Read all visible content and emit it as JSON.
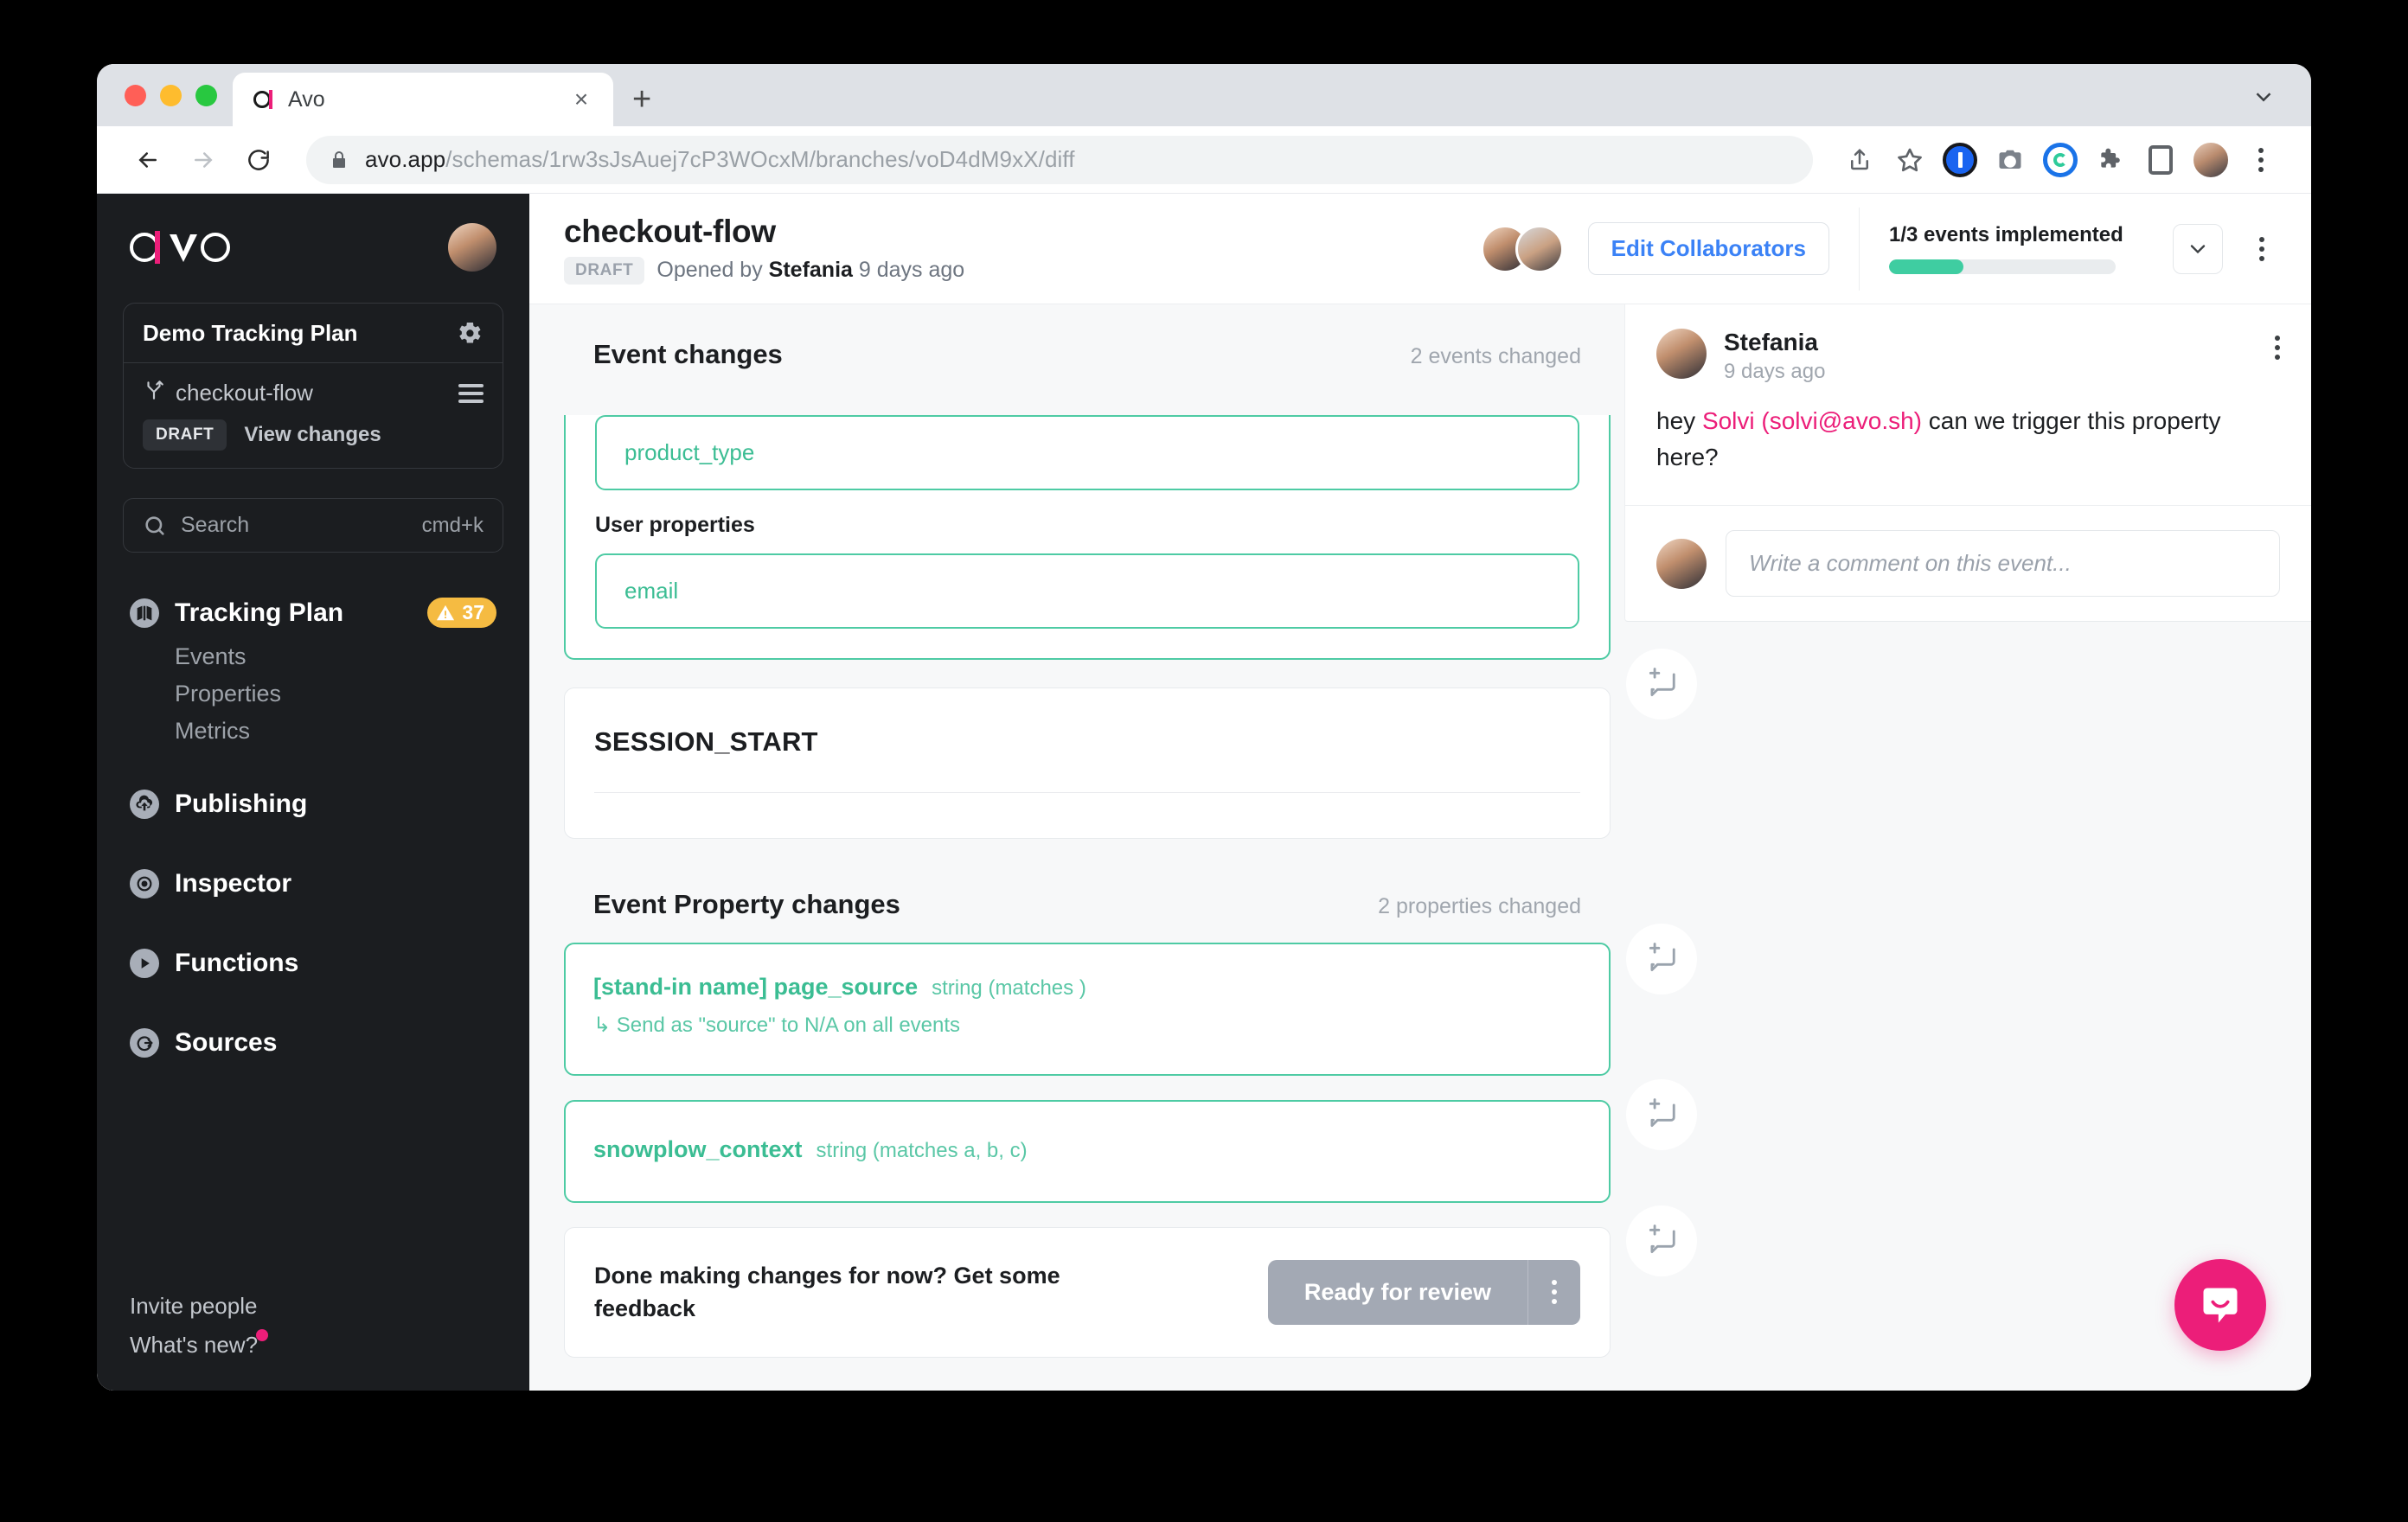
{
  "browser": {
    "tab": {
      "title": "Avo",
      "favicon": "avo-logo-icon",
      "close_icon": "close-icon"
    },
    "new_tab_icon": "plus-icon",
    "tab_list_icon": "chevron-down-icon",
    "back_icon": "back-arrow-icon",
    "forward_icon": "forward-arrow-icon",
    "reload_icon": "reload-icon",
    "url": {
      "host": "avo.app",
      "path": "/schemas/1rw3sJsAuej7cP3WOcxM/branches/voD4dM9xX/diff",
      "lock_icon": "lock-icon"
    },
    "toolbar_icons": [
      "share-icon",
      "bookmark-star-icon",
      "1password-icon",
      "screenshot-camera-icon",
      "sync-circle-icon",
      "extensions-puzzle-icon",
      "side-panel-icon",
      "profile-avatar-icon",
      "chrome-menu-icon"
    ]
  },
  "sidebar": {
    "logo": "avo-logo",
    "avatar": "user-avatar",
    "plan": {
      "name": "Demo Tracking Plan",
      "settings_icon": "gear-icon"
    },
    "branch": {
      "name": "checkout-flow",
      "branch_icon": "branch-icon",
      "menu_icon": "hamburger-icon",
      "status": "DRAFT",
      "action": "View changes"
    },
    "search": {
      "placeholder": "Search",
      "shortcut": "cmd+k",
      "icon": "search-icon"
    },
    "nav": [
      {
        "label": "Tracking Plan",
        "icon": "map-icon",
        "badge": "37",
        "badge_icon": "warning-icon",
        "children": [
          "Events",
          "Properties",
          "Metrics"
        ]
      },
      {
        "label": "Publishing",
        "icon": "cloud-upload-icon"
      },
      {
        "label": "Inspector",
        "icon": "target-icon"
      },
      {
        "label": "Functions",
        "icon": "play-icon"
      },
      {
        "label": "Sources",
        "icon": "source-icon"
      }
    ],
    "footer": [
      {
        "label": "Invite people",
        "dot": false
      },
      {
        "label": "What's new?",
        "dot": true
      }
    ]
  },
  "header": {
    "title": "checkout-flow",
    "status": "DRAFT",
    "opened_prefix": "Opened by",
    "opened_by": "Stefania",
    "opened_when": "9 days ago",
    "collaborators_button": "Edit Collaborators",
    "progress_label": "1/3 events implemented",
    "progress_percent": 33,
    "progress_color": "#3fcda1",
    "expand_icon": "chevron-down-icon",
    "more_icon": "kebab-menu-icon"
  },
  "main": {
    "event_changes": {
      "title": "Event changes",
      "count": "2 events changed",
      "event_properties": [
        {
          "name": "product_type"
        }
      ],
      "user_properties_label": "User properties",
      "user_properties": [
        {
          "name": "email"
        }
      ]
    },
    "session_event": {
      "name": "SESSION_START"
    },
    "property_changes": {
      "title": "Event Property changes",
      "count": "2 properties changed",
      "items": [
        {
          "name": "[stand-in name] page_source",
          "type": "string (matches )",
          "detail": "↳ Send as \"source\" to N/A on all events"
        },
        {
          "name": "snowplow_context",
          "type": "string (matches a, b, c)",
          "detail": ""
        }
      ]
    },
    "cta": {
      "text": "Done making changes for now? Get some feedback",
      "button": "Ready for review",
      "menu_icon": "kebab-menu-icon"
    },
    "add_comment_icon": "add-comment-icon"
  },
  "comment_panel": {
    "author": "Stefania",
    "time": "9 days ago",
    "more_icon": "kebab-menu-icon",
    "body_before": "hey ",
    "mention": "Solvi (solvi@avo.sh)",
    "body_after": " can we trigger this property here?",
    "input_placeholder": "Write a comment on this event..."
  },
  "intercom": {
    "icon": "intercom-chat-icon",
    "color": "#ec1e79"
  }
}
